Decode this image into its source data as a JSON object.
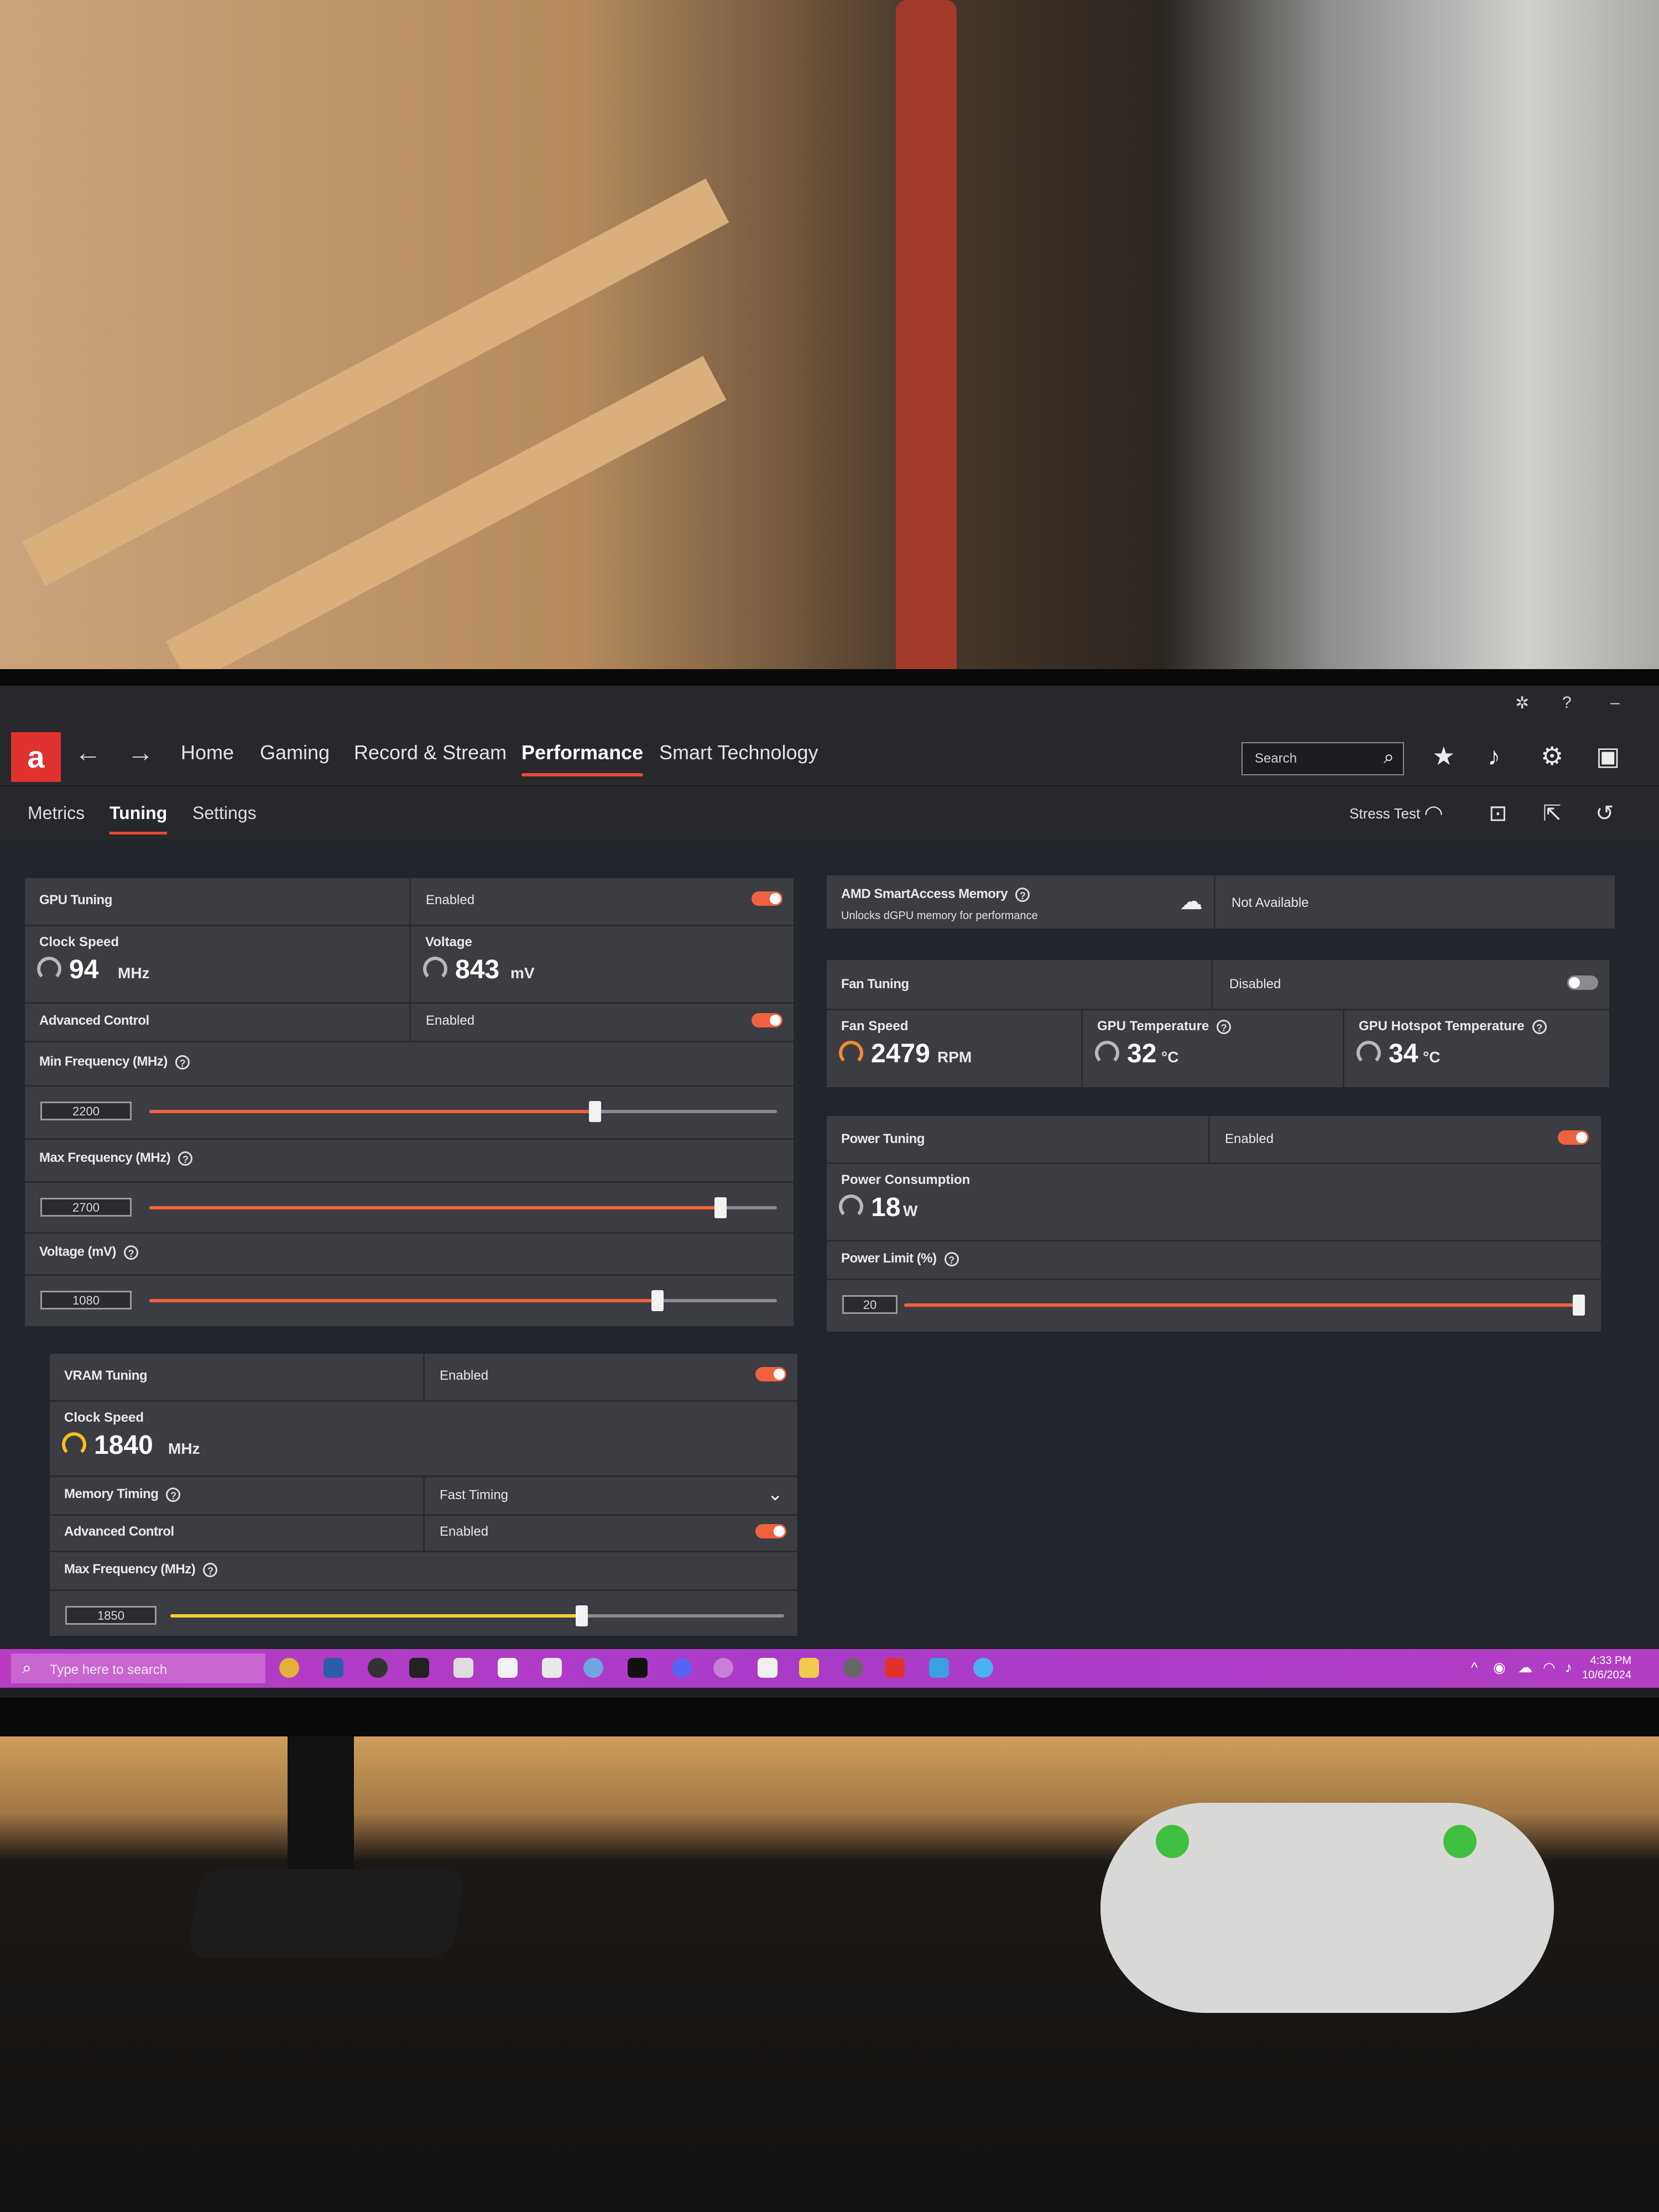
{
  "nav": {
    "logo": "a",
    "back_icon": "←",
    "forward_icon": "→",
    "items": [
      "Home",
      "Gaming",
      "Record & Stream",
      "Performance",
      "Smart Technology"
    ],
    "search_placeholder": "Search"
  },
  "subnav": {
    "items": [
      "Metrics",
      "Tuning",
      "Settings"
    ],
    "stress_test": "Stress Test"
  },
  "gpu_tuning": {
    "title": "GPU Tuning",
    "state": "Enabled",
    "clock_label": "Clock Speed",
    "clock_value": "94",
    "clock_unit": "MHz",
    "voltage_label": "Voltage",
    "voltage_value": "843",
    "voltage_unit": "mV",
    "advanced_label": "Advanced Control",
    "advanced_state": "Enabled",
    "min_freq_label": "Min Frequency (MHz)",
    "min_freq_value": "2200",
    "min_freq_fraction": 0.71,
    "max_freq_label": "Max Frequency (MHz)",
    "max_freq_value": "2700",
    "max_freq_fraction": 0.91,
    "volt_slider_label": "Voltage (mV)",
    "volt_slider_value": "1080",
    "volt_slider_fraction": 0.81
  },
  "vram_tuning": {
    "title": "VRAM Tuning",
    "state": "Enabled",
    "clock_label": "Clock Speed",
    "clock_value": "1840",
    "clock_unit": "MHz",
    "memory_timing_label": "Memory Timing",
    "memory_timing_value": "Fast Timing",
    "advanced_label": "Advanced Control",
    "advanced_state": "Enabled",
    "max_freq_label": "Max Frequency (MHz)",
    "max_freq_value": "1850",
    "max_freq_fraction": 0.67
  },
  "smart_access": {
    "title": "AMD SmartAccess Memory",
    "subtitle": "Unlocks dGPU memory for performance",
    "state": "Not Available"
  },
  "fan_tuning": {
    "title": "Fan Tuning",
    "state": "Disabled",
    "fan_speed_label": "Fan Speed",
    "fan_speed_value": "2479",
    "fan_speed_unit": "RPM",
    "gpu_temp_label": "GPU Temperature",
    "gpu_temp_value": "32",
    "gpu_temp_unit": "°C",
    "hotspot_label": "GPU Hotspot Temperature",
    "hotspot_value": "34",
    "hotspot_unit": "°C"
  },
  "power_tuning": {
    "title": "Power Tuning",
    "state": "Enabled",
    "consumption_label": "Power Consumption",
    "consumption_value": "18",
    "consumption_unit": "W",
    "limit_label": "Power Limit (%)",
    "limit_value": "20",
    "limit_fraction": 1.0
  },
  "taskbar": {
    "search_placeholder": "Type here to search",
    "time": "4:33 PM",
    "date": "10/6/2024"
  },
  "colors": {
    "accent": "#e94a33",
    "slider_fill": "#f0623f",
    "vram_fill": "#f2cf3a",
    "taskbar": "#b23ec3"
  }
}
